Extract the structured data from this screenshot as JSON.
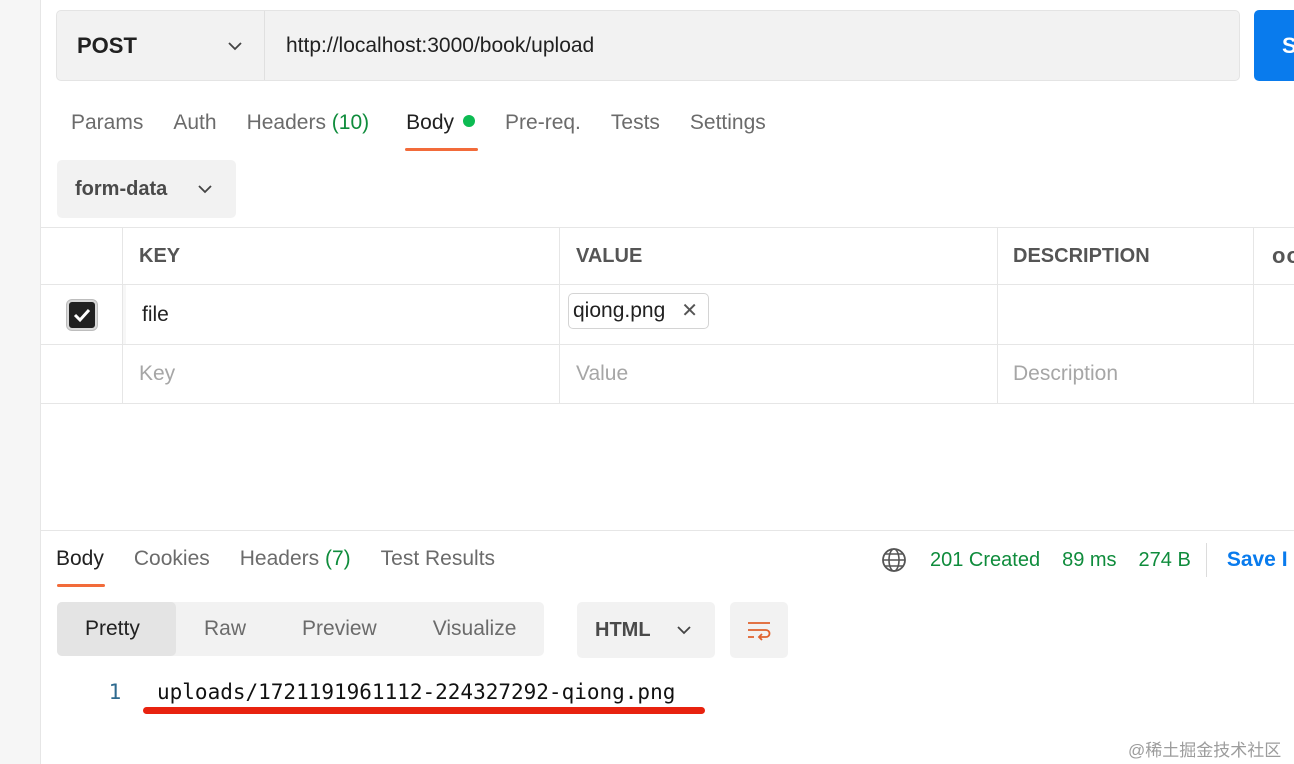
{
  "request": {
    "method": "POST",
    "url": "http://localhost:3000/book/upload",
    "send_label": "S"
  },
  "request_tabs": [
    {
      "label": "Params"
    },
    {
      "label": "Auth"
    },
    {
      "label": "Headers",
      "count": "(10)"
    },
    {
      "label": "Body"
    },
    {
      "label": "Pre-req."
    },
    {
      "label": "Tests"
    },
    {
      "label": "Settings"
    }
  ],
  "body_mode": "form-data",
  "params_table": {
    "headers": [
      "KEY",
      "VALUE",
      "DESCRIPTION",
      "ooo"
    ],
    "rows": [
      {
        "key": "file",
        "value": "qiong.png",
        "checked": true
      }
    ],
    "placeholders": {
      "key": "Key",
      "value": "Value",
      "description": "Description"
    }
  },
  "response_tabs": [
    {
      "label": "Body"
    },
    {
      "label": "Cookies"
    },
    {
      "label": "Headers",
      "count": "(7)"
    },
    {
      "label": "Test Results"
    }
  ],
  "response_status": {
    "status": "201 Created",
    "time": "89 ms",
    "size": "274 B",
    "save_label": "Save I"
  },
  "format_tabs": [
    "Pretty",
    "Raw",
    "Preview",
    "Visualize"
  ],
  "language": "HTML",
  "response_body": {
    "line_number": "1",
    "text": "uploads/1721191961112-224327292-qiong.png"
  },
  "watermark": "@稀土掘金技术社区",
  "colors": {
    "accent": "#f26b3a",
    "send": "#097bed",
    "status": "#0f8c3c",
    "highlight": "#e8220f"
  }
}
